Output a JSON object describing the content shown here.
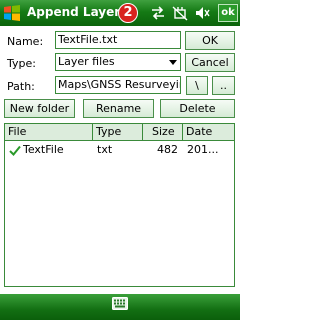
{
  "titlebar": {
    "title": "Append Layer",
    "badge": "2",
    "ok_label": "ok",
    "icons": [
      "windows-start-icon",
      "sync-arrows-icon",
      "network-off-icon",
      "volume-icon"
    ]
  },
  "form": {
    "name_label": "Name:",
    "name_value": "TextFile.txt",
    "type_label": "Type:",
    "type_value": "Layer files",
    "path_label": "Path:",
    "path_value": "Maps\\GNSS Resurveying",
    "ok_button": "OK",
    "cancel_button": "Cancel",
    "root_button": "\\",
    "up_button": ".."
  },
  "toolbar": {
    "new_folder": "New folder",
    "rename": "Rename",
    "delete": "Delete"
  },
  "list": {
    "columns": [
      "File",
      "Type",
      "Size",
      "Date"
    ],
    "rows": [
      {
        "name": "TextFile",
        "type": "txt",
        "size": "482",
        "date": "201..."
      }
    ]
  },
  "colors": {
    "accent": "#157a15",
    "border": "#3a8a3a",
    "header_fill": "#dcecdc",
    "badge": "#d8231e"
  }
}
